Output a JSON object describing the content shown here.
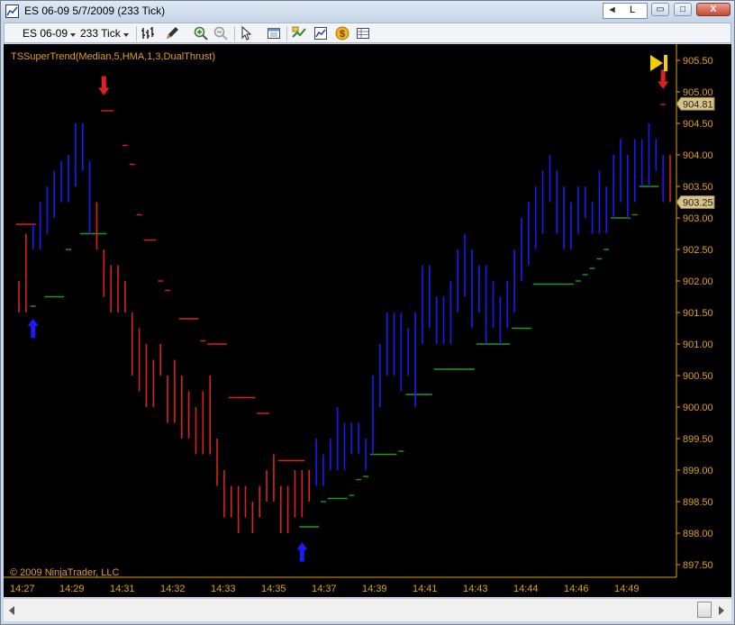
{
  "window": {
    "title": "ES 06-09  5/7/2009 (233 Tick)",
    "link_field_value": "L",
    "minimize_symbol": "▭",
    "maximize_symbol": "□",
    "close_symbol": "X"
  },
  "toolbar": {
    "instrument": "ES 06-09",
    "interval": "233 Tick",
    "icons": [
      "bar-type-icon",
      "drawing-tool-icon",
      "zoom-in-icon",
      "zoom-out-icon",
      "pointer-icon",
      "properties-icon",
      "data-box-icon",
      "strategies-icon",
      "chart-trader-icon",
      "grid-view-icon"
    ]
  },
  "chart": {
    "indicator_label": "TSSuperTrend(Median,5,HMA,1,3,DualThrust)",
    "copyright": "© 2009 NinjaTrader, LLC",
    "price_ticks": [
      "905.50",
      "905.00",
      "904.50",
      "904.00",
      "903.50",
      "903.00",
      "902.50",
      "902.00",
      "901.50",
      "901.00",
      "900.50",
      "900.00",
      "899.50",
      "899.00",
      "898.50",
      "898.00",
      "897.50"
    ],
    "time_ticks": [
      "14:27",
      "14:29",
      "14:31",
      "14:32",
      "14:33",
      "14:35",
      "14:37",
      "14:39",
      "14:41",
      "14:43",
      "14:44",
      "14:46",
      "14:49"
    ],
    "price_markers": [
      "904.81",
      "903.25"
    ],
    "colors": {
      "background": "#000000",
      "up_bar": "#1a1aff",
      "down_bar": "#dd2020",
      "stop_up": "#1e9a1e",
      "stop_down": "#dd2020",
      "axis": "#e0a020",
      "marker_bg": "#d9c58a"
    }
  },
  "chart_data": {
    "type": "bar",
    "title": "TSSuperTrend(Median,5,HMA,1,3,DualThrust)",
    "ylim": [
      897.25,
      905.75
    ],
    "y_ticks": [
      905.5,
      905.0,
      904.5,
      904.0,
      903.5,
      903.0,
      902.5,
      902.0,
      901.5,
      901.0,
      900.5,
      900.0,
      899.5,
      899.0,
      898.5,
      898.0,
      897.5
    ],
    "x_ticks": [
      "14:27",
      "14:29",
      "14:31",
      "14:32",
      "14:33",
      "14:35",
      "14:37",
      "14:39",
      "14:41",
      "14:43",
      "14:44",
      "14:46",
      "14:49"
    ],
    "bars": [
      [
        902.0,
        901.5,
        "d"
      ],
      [
        902.75,
        901.5,
        "d"
      ],
      [
        902.9,
        902.5,
        "u"
      ],
      [
        903.25,
        902.5,
        "u"
      ],
      [
        903.5,
        902.75,
        "u"
      ],
      [
        903.75,
        903.0,
        "u"
      ],
      [
        903.9,
        903.25,
        "u"
      ],
      [
        904.0,
        903.25,
        "u"
      ],
      [
        904.5,
        903.5,
        "u"
      ],
      [
        904.5,
        903.75,
        "u"
      ],
      [
        903.9,
        902.75,
        "u"
      ],
      [
        903.25,
        902.5,
        "d"
      ],
      [
        902.5,
        901.75,
        "d"
      ],
      [
        902.25,
        901.5,
        "d"
      ],
      [
        902.25,
        901.5,
        "d"
      ],
      [
        902.0,
        901.5,
        "d"
      ],
      [
        901.5,
        900.5,
        "d"
      ],
      [
        901.25,
        900.25,
        "d"
      ],
      [
        901.0,
        900.0,
        "d"
      ],
      [
        900.75,
        900.0,
        "d"
      ],
      [
        901.0,
        900.5,
        "d"
      ],
      [
        900.5,
        899.75,
        "d"
      ],
      [
        900.75,
        899.75,
        "d"
      ],
      [
        900.5,
        899.5,
        "d"
      ],
      [
        900.25,
        899.5,
        "d"
      ],
      [
        900.0,
        899.25,
        "d"
      ],
      [
        900.25,
        899.25,
        "d"
      ],
      [
        900.5,
        899.25,
        "d"
      ],
      [
        899.5,
        898.75,
        "d"
      ],
      [
        899.0,
        898.25,
        "d"
      ],
      [
        898.75,
        898.25,
        "d"
      ],
      [
        898.75,
        898.0,
        "d"
      ],
      [
        898.75,
        898.25,
        "d"
      ],
      [
        898.5,
        898.0,
        "d"
      ],
      [
        898.75,
        898.25,
        "d"
      ],
      [
        899.0,
        898.5,
        "d"
      ],
      [
        899.25,
        898.5,
        "d"
      ],
      [
        898.75,
        898.0,
        "d"
      ],
      [
        898.75,
        898.0,
        "d"
      ],
      [
        899.0,
        898.25,
        "d"
      ],
      [
        899.0,
        898.25,
        "d"
      ],
      [
        899.0,
        898.5,
        "d"
      ],
      [
        899.5,
        898.75,
        "u"
      ],
      [
        899.25,
        898.75,
        "u"
      ],
      [
        899.5,
        899.0,
        "u"
      ],
      [
        900.0,
        899.0,
        "u"
      ],
      [
        899.75,
        899.0,
        "u"
      ],
      [
        899.75,
        899.25,
        "u"
      ],
      [
        899.75,
        899.25,
        "u"
      ],
      [
        899.5,
        899.0,
        "u"
      ],
      [
        900.5,
        899.25,
        "u"
      ],
      [
        901.0,
        900.0,
        "u"
      ],
      [
        901.5,
        900.5,
        "u"
      ],
      [
        901.5,
        900.5,
        "u"
      ],
      [
        901.5,
        900.25,
        "u"
      ],
      [
        901.25,
        900.5,
        "u"
      ],
      [
        901.5,
        900.0,
        "u"
      ],
      [
        902.25,
        901.0,
        "u"
      ],
      [
        902.25,
        901.25,
        "u"
      ],
      [
        901.75,
        901.0,
        "u"
      ],
      [
        901.75,
        901.0,
        "u"
      ],
      [
        902.0,
        901.0,
        "u"
      ],
      [
        902.5,
        901.5,
        "u"
      ],
      [
        902.75,
        901.75,
        "u"
      ],
      [
        902.5,
        901.25,
        "u"
      ],
      [
        902.25,
        901.5,
        "u"
      ],
      [
        902.25,
        901.0,
        "u"
      ],
      [
        902.0,
        901.25,
        "u"
      ],
      [
        901.75,
        901.0,
        "u"
      ],
      [
        902.0,
        901.25,
        "u"
      ],
      [
        902.5,
        901.5,
        "u"
      ],
      [
        903.0,
        902.0,
        "u"
      ],
      [
        903.25,
        902.25,
        "u"
      ],
      [
        903.5,
        902.5,
        "u"
      ],
      [
        903.75,
        902.75,
        "u"
      ],
      [
        904.0,
        903.25,
        "u"
      ],
      [
        903.75,
        902.75,
        "u"
      ],
      [
        903.5,
        902.5,
        "u"
      ],
      [
        903.25,
        902.5,
        "u"
      ],
      [
        903.5,
        902.75,
        "u"
      ],
      [
        903.5,
        903.0,
        "u"
      ],
      [
        903.25,
        902.75,
        "u"
      ],
      [
        903.75,
        902.75,
        "u"
      ],
      [
        903.5,
        902.75,
        "u"
      ],
      [
        904.0,
        903.0,
        "u"
      ],
      [
        904.25,
        903.25,
        "u"
      ],
      [
        904.0,
        903.0,
        "u"
      ],
      [
        904.25,
        903.25,
        "u"
      ],
      [
        904.25,
        903.5,
        "u"
      ],
      [
        904.5,
        903.5,
        "u"
      ],
      [
        904.25,
        903.75,
        "u"
      ],
      [
        904.0,
        903.25,
        "u"
      ],
      [
        904.0,
        903.25,
        "d"
      ]
    ],
    "supertrend_segments": [
      {
        "color": "red",
        "points": [
          [
            902.9,
            0,
            2
          ]
        ]
      },
      {
        "color": "green",
        "points": [
          [
            901.6,
            2,
            2
          ],
          [
            901.75,
            4,
            6
          ],
          [
            902.5,
            7,
            7
          ],
          [
            902.75,
            9,
            12
          ]
        ]
      },
      {
        "color": "red",
        "points": [
          [
            904.7,
            12,
            13
          ],
          [
            904.15,
            15,
            15
          ],
          [
            903.85,
            16,
            16
          ],
          [
            903.05,
            17,
            17
          ],
          [
            902.65,
            18,
            19
          ],
          [
            902.0,
            20,
            20
          ],
          [
            901.85,
            21,
            21
          ],
          [
            901.4,
            23,
            25
          ],
          [
            901.05,
            26,
            26
          ],
          [
            901.0,
            27,
            29
          ],
          [
            900.15,
            30,
            33
          ],
          [
            899.9,
            34,
            35
          ],
          [
            899.15,
            37,
            40
          ]
        ]
      },
      {
        "color": "green",
        "points": [
          [
            898.1,
            40,
            42
          ],
          [
            898.5,
            43,
            43
          ],
          [
            898.55,
            44,
            46
          ],
          [
            898.6,
            47,
            47
          ],
          [
            898.85,
            48,
            48
          ],
          [
            898.9,
            49,
            49
          ],
          [
            899.25,
            50,
            53
          ],
          [
            899.3,
            54,
            54
          ],
          [
            900.2,
            55,
            58
          ],
          [
            900.6,
            59,
            64
          ],
          [
            901.0,
            65,
            69
          ],
          [
            901.25,
            70,
            72
          ],
          [
            901.95,
            73,
            78
          ],
          [
            902.0,
            79,
            79
          ],
          [
            902.1,
            80,
            80
          ],
          [
            902.2,
            81,
            81
          ],
          [
            902.35,
            82,
            82
          ],
          [
            902.5,
            83,
            83
          ],
          [
            903.0,
            84,
            86
          ],
          [
            903.05,
            87,
            87
          ],
          [
            903.5,
            88,
            90
          ]
        ]
      },
      {
        "color": "red",
        "points": [
          [
            904.8,
            91,
            91
          ]
        ]
      }
    ],
    "signal_arrows": [
      {
        "dir": "up",
        "bar": 2,
        "price": 901.25
      },
      {
        "dir": "down",
        "bar": 12,
        "price": 905.1
      },
      {
        "dir": "up",
        "bar": 40,
        "price": 897.7
      },
      {
        "dir": "down",
        "bar": 91,
        "price": 905.2
      }
    ]
  }
}
